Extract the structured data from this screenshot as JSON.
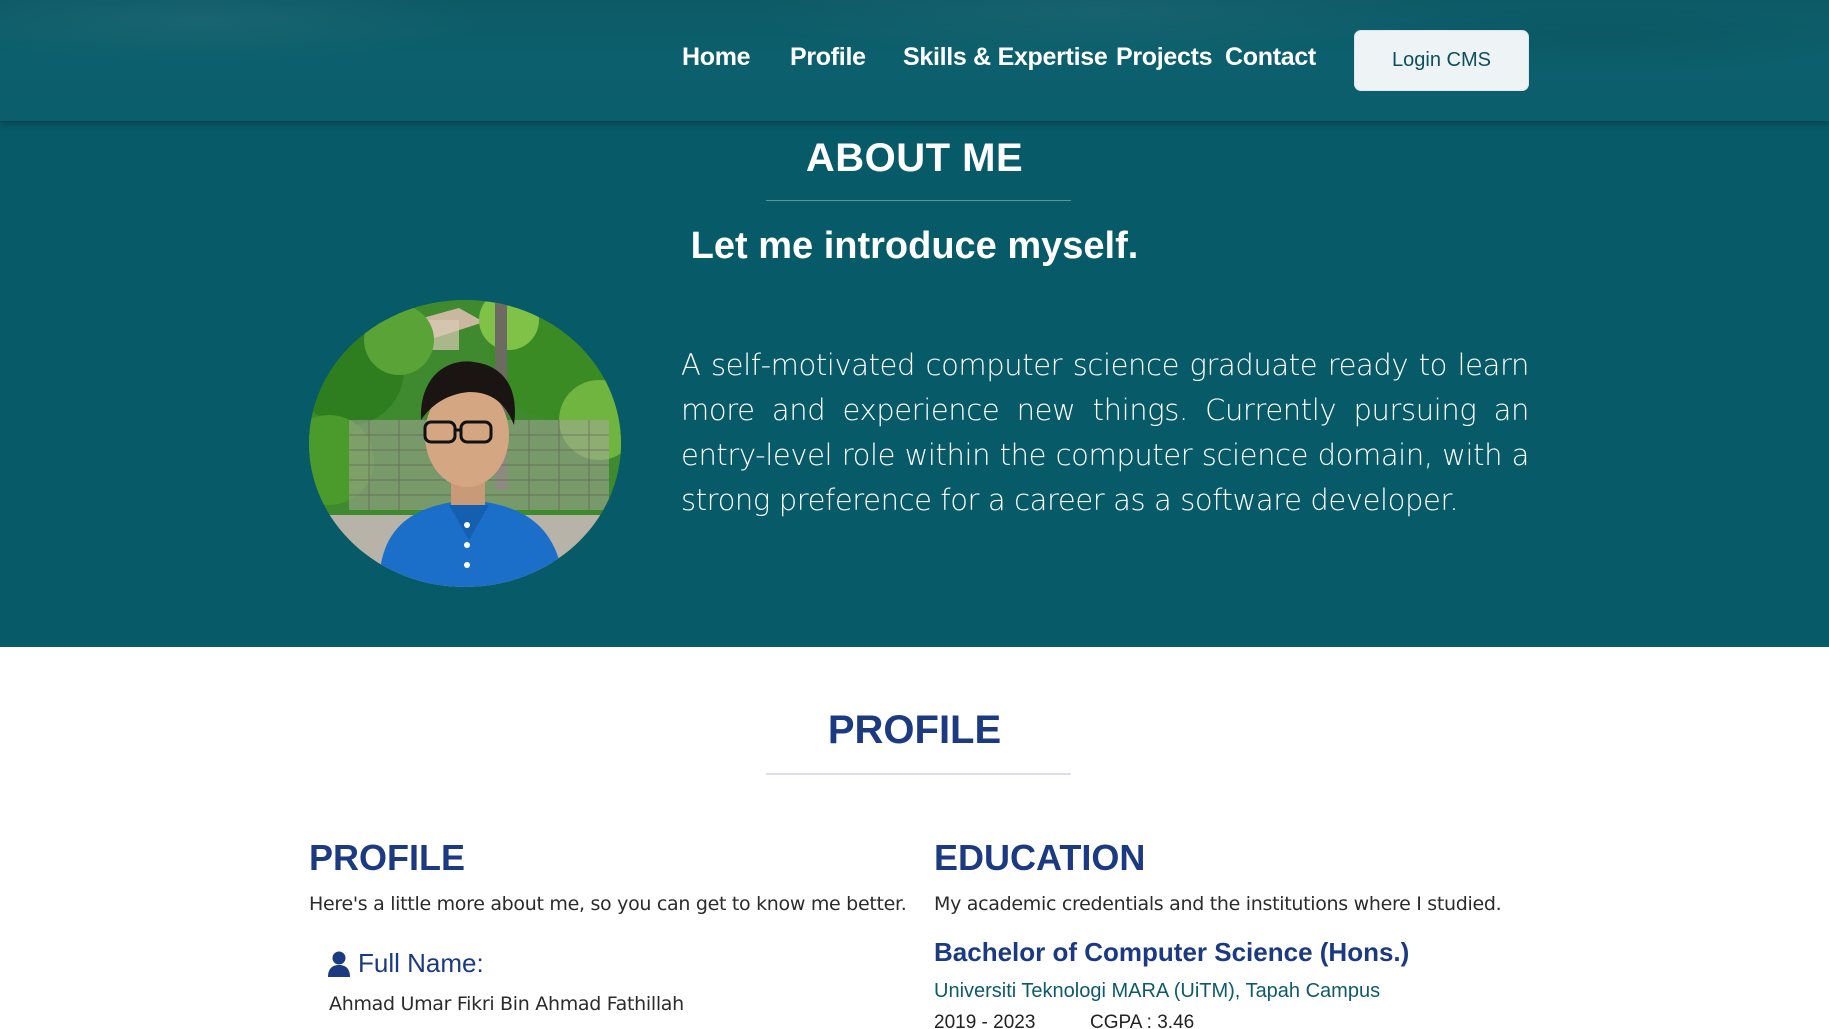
{
  "nav": {
    "links": [
      "Home",
      "Profile",
      "Skills & Expertise",
      "Projects",
      "Contact"
    ],
    "login_label": "Login CMS"
  },
  "about": {
    "title": "ABOUT ME",
    "subtitle": "Let me introduce myself.",
    "text": "A self-motivated computer science graduate ready to learn more and experience new things. Currently pursuing an entry-level role within the computer science domain, with a strong preference for a career as a software developer."
  },
  "profile": {
    "heading": "PROFILE",
    "left": {
      "title": "PROFILE",
      "description": "Here's a little more about me, so you can get to know me better.",
      "fullname_label": "Full Name:",
      "fullname_value": "Ahmad Umar Fikri Bin Ahmad Fathillah",
      "fullname_icon": "user-icon"
    },
    "right": {
      "title": "EDUCATION",
      "description": "My academic credentials and the institutions where I studied.",
      "degree": "Bachelor of Computer Science (Hons.)",
      "university": "Universiti Teknologi MARA (UiTM), Tapah Campus",
      "years": "2019 - 2023",
      "cgpa": "CGPA : 3.46"
    }
  },
  "colors": {
    "nav_bg": "#0c5f6c",
    "about_bg": "#075a68",
    "heading_blue": "#1c3a82",
    "university_teal": "#0e5a6a"
  }
}
